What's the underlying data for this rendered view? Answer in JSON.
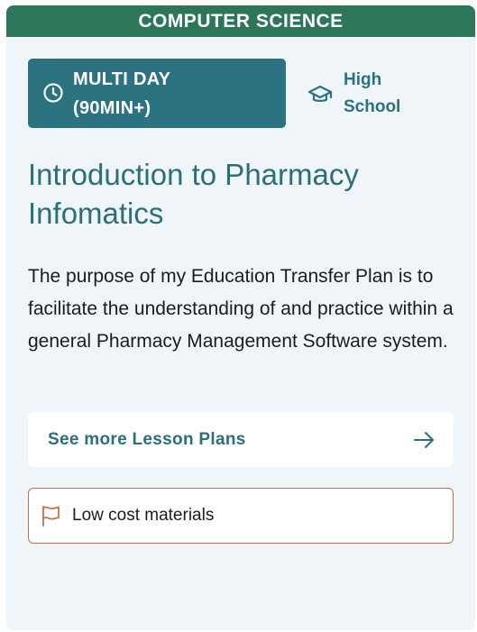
{
  "card": {
    "category": "COMPUTER SCIENCE",
    "duration": "MULTI DAY (90MIN+)",
    "grade": "High School",
    "title": "Introduction to Pharmacy Infomatics",
    "description": "The purpose of my Education Transfer Plan is to facilitate the understanding of and practice within a general Pharmacy Management Software system.",
    "more_button_label": "See more Lesson Plans",
    "materials_label": "Low cost materials"
  },
  "icons": {
    "duration": "clock-icon",
    "grade": "graduation-cap-icon",
    "more": "arrow-right-icon",
    "materials": "flag-icon"
  },
  "colors": {
    "category_bg": "#2d7659",
    "accent": "#2b7381",
    "card_bg": "#eff5f8",
    "materials_border": "#c9704a"
  }
}
